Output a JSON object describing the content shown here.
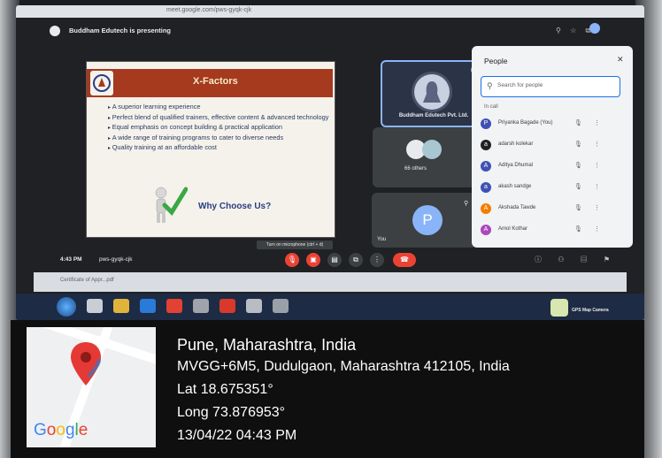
{
  "browser": {
    "url_fragment": "meet.google.com/pws-gyqk-cjk"
  },
  "meet": {
    "presenting_text": "Buddham Edutech is presenting",
    "time": "4:43 PM",
    "meeting_code": "pws-gyqk-cjk",
    "mic_tooltip": "Turn on microphone (ctrl + d)"
  },
  "slide": {
    "title": "X-Factors",
    "bullets": [
      "A superior learning experience",
      "Perfect blend of qualified trainers, effective content & advanced technology",
      "Equal emphasis on concept building & practical application",
      "A wide range of training programs to cater to diverse needs",
      "Quality training at an affordable cost"
    ],
    "cta": "Why Choose Us?"
  },
  "tiles": {
    "org_label": "Buddham Edutech Pvt. Ltd.",
    "others_label": "66 others",
    "you_initial": "P",
    "you_label": "You"
  },
  "people": {
    "title": "People",
    "search_placeholder": "Search for people",
    "in_call_label": "In call",
    "rows": [
      {
        "initial": "P",
        "name": "Priyanka Bagade (You)",
        "color": "#3f51b5"
      },
      {
        "initial": "a",
        "name": "adarsh kolekar",
        "color": "#202124"
      },
      {
        "initial": "A",
        "name": "Aditya Dhumal",
        "color": "#3f51b5"
      },
      {
        "initial": "a",
        "name": "akash sandge",
        "color": "#3f51b5"
      },
      {
        "initial": "A",
        "name": "Akshada Tawde",
        "color": "#f57c00"
      },
      {
        "initial": "A",
        "name": "Amol Kothar",
        "color": "#ab47bc"
      }
    ]
  },
  "taskbar": {
    "gps_app_label": "GPS Map Camera",
    "notif_file": "Certificate of Appr...pdf"
  },
  "location": {
    "city": "Pune, Maharashtra, India",
    "address": "MVGG+6M5, Dudulgaon, Maharashtra 412105, India",
    "lat": "Lat 18.675351°",
    "long": "Long 73.876953°",
    "datetime": "13/04/22 04:43 PM",
    "map_brand": "Google"
  }
}
